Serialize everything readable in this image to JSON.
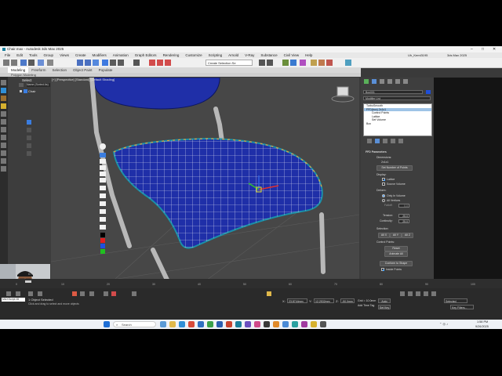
{
  "window": {
    "title": "Chair.max - Autodesk 3ds Max 2025",
    "controls": [
      "minimize",
      "maximize",
      "close"
    ]
  },
  "menubar": {
    "items": [
      "File",
      "Edit",
      "Tools",
      "Group",
      "Views",
      "Create",
      "Modifiers",
      "Animation",
      "Graph Editors",
      "Rendering",
      "Customize",
      "Scripting",
      "Arnold",
      "V-Ray",
      "Substance",
      "Civil View",
      "Help"
    ],
    "user": "Uh_Kemi3195",
    "workspace": "3ds Max 2025",
    "create_selection_set": "Create Selection Se"
  },
  "ribbon": {
    "tabs": [
      "Modeling",
      "Freeform",
      "Selection",
      "Object Paint",
      "Populate"
    ],
    "active": "Modeling",
    "subpanel": "Polygon Modeling"
  },
  "scene_explorer": {
    "header": "Select",
    "filter_label": "Name (Sorted As)",
    "items": [
      "Chair"
    ],
    "frame_counter": "0 / 100"
  },
  "viewport": {
    "label": "[+] [Perspective] [Standard] [Default Shading]",
    "seat_color": "#1f2fa8",
    "grid_color": "#ffffff"
  },
  "command_panel": {
    "object_name": "Box001",
    "object_color": "#1f4fd8",
    "modifier_list": "Modifier List",
    "stack": [
      {
        "label": "TurboSmooth",
        "selected": false
      },
      {
        "label": "FFD(box) 2x1x1",
        "selected": true
      },
      {
        "label": "Control Points",
        "selected": false
      },
      {
        "label": "Lattice",
        "selected": false
      },
      {
        "label": "Set Volume",
        "selected": false
      },
      {
        "label": "Box",
        "selected": false
      }
    ],
    "ffd": {
      "rollout_title": "FFD Parameters",
      "dimensions_label": "Dimensions:",
      "dimensions_value": "2x1x1",
      "set_points_button": "Set Number of Points",
      "display_label": "Display:",
      "display_lattice": "Lattice",
      "display_lattice_checked": true,
      "display_source_volume": "Source Volume",
      "display_source_checked": false,
      "deform_label": "Deform:",
      "deform_only_in_volume": "Only In Volume",
      "deform_all_vertices": "All Vertices",
      "falloff_label": "Falloff:",
      "falloff_value": "0.0",
      "tension_label": "Tension:",
      "tension_value": "25.0",
      "continuity_label": "Continuity:",
      "continuity_value": "25.0",
      "selection_label": "Selection:",
      "sel_buttons": [
        "All X",
        "All Y",
        "All Z"
      ],
      "control_points_label": "Control Points:",
      "reset_button": "Reset",
      "animate_all_button": "Animate All",
      "conform_button": "Conform to Shape",
      "inside_points": "Inside Points",
      "inside_points_checked": true
    }
  },
  "timeline": {
    "ticks": [
      "0",
      "10",
      "20",
      "30",
      "40",
      "50",
      "60",
      "70",
      "80",
      "90",
      "100"
    ]
  },
  "status": {
    "selection": "1 Object Selected",
    "prompt": "Click and drag to select and move objects",
    "x_label": "X:",
    "x_value": "23.8744mm",
    "y_label": "Y:",
    "y_value": "12.2532mm",
    "z_label": "Z:",
    "z_value": "-50.0mm",
    "grid": "Grid = 10.0mm",
    "add_time_tag": "Add Time Tag",
    "autokey": "Auto Key",
    "set_key": "Set Key",
    "selected": "Selected",
    "key_filters": "Key Filters...",
    "maxscript": "MAXScript Mi"
  },
  "taskbar": {
    "search_placeholder": "Search",
    "time": "1:58 PM",
    "date": "9/26/2025"
  }
}
